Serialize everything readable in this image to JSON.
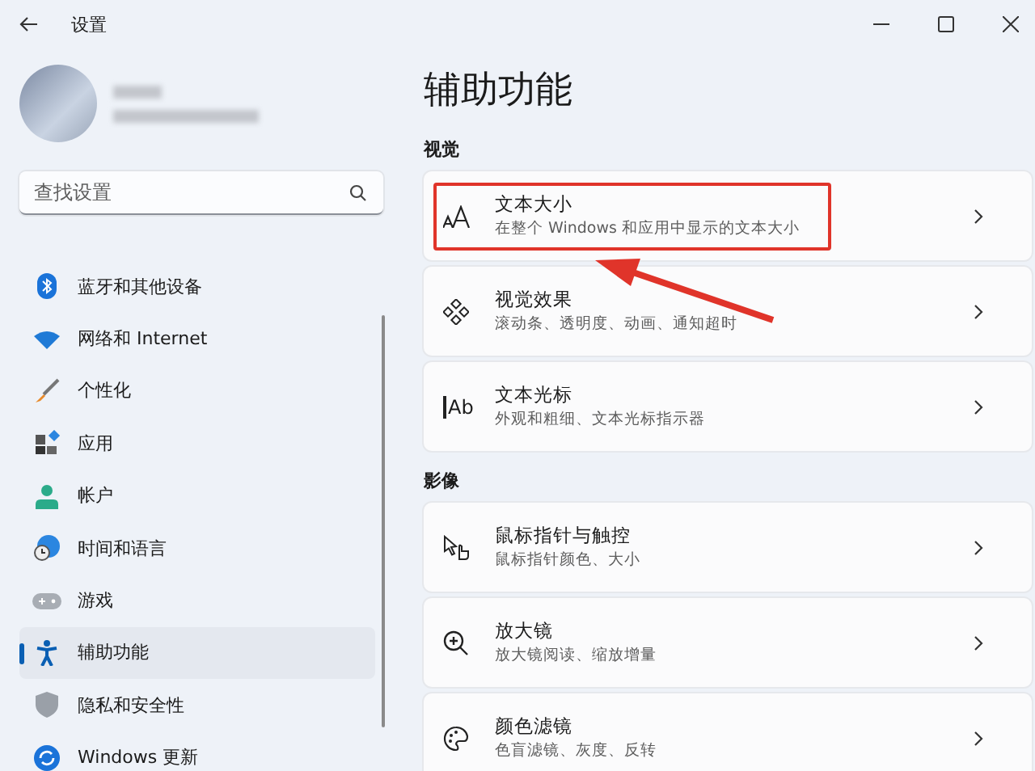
{
  "window": {
    "title": "设置"
  },
  "search": {
    "placeholder": "查找设置"
  },
  "nav": [
    {
      "label": "蓝牙和其他设备",
      "selected": false
    },
    {
      "label": "网络和 Internet",
      "selected": false
    },
    {
      "label": "个性化",
      "selected": false
    },
    {
      "label": "应用",
      "selected": false
    },
    {
      "label": "帐户",
      "selected": false
    },
    {
      "label": "时间和语言",
      "selected": false
    },
    {
      "label": "游戏",
      "selected": false
    },
    {
      "label": "辅助功能",
      "selected": true
    },
    {
      "label": "隐私和安全性",
      "selected": false
    },
    {
      "label": "Windows 更新",
      "selected": false
    }
  ],
  "page_title": "辅助功能",
  "sections": [
    {
      "heading": "视觉",
      "cards": [
        {
          "title": "文本大小",
          "subtitle": "在整个 Windows 和应用中显示的文本大小",
          "highlighted": true
        },
        {
          "title": "视觉效果",
          "subtitle": "滚动条、透明度、动画、通知超时",
          "highlighted": false
        },
        {
          "title": "文本光标",
          "subtitle": "外观和粗细、文本光标指示器",
          "icon_text": "Ab",
          "highlighted": false
        }
      ]
    },
    {
      "heading": "影像",
      "cards": [
        {
          "title": "鼠标指针与触控",
          "subtitle": "鼠标指针颜色、大小",
          "highlighted": false
        },
        {
          "title": "放大镜",
          "subtitle": "放大镜阅读、缩放增量",
          "highlighted": false
        },
        {
          "title": "颜色滤镜",
          "subtitle": "色盲滤镜、灰度、反转",
          "highlighted": false
        }
      ]
    }
  ],
  "annotation": {
    "arrow": true
  }
}
